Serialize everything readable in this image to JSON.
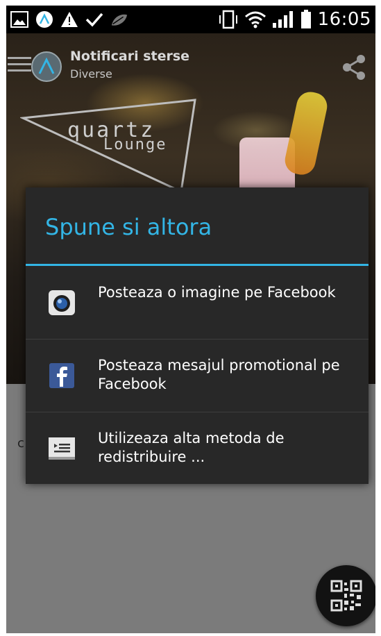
{
  "status_bar": {
    "time": "16:05",
    "left_icons": [
      "image-notification-icon",
      "app-notification-icon",
      "warning-icon",
      "check-icon",
      "leaf-icon"
    ],
    "right_icons": [
      "vibrate-icon",
      "wifi-icon",
      "signal-icon",
      "battery-icon"
    ]
  },
  "app_bar": {
    "title": "Notificari sterse",
    "subtitle": "Diverse"
  },
  "brand": {
    "name": "quartz",
    "sub": "Lounge"
  },
  "background_text": "c",
  "dialog": {
    "title": "Spune si altora",
    "options": [
      {
        "label": "Posteaza o imagine pe Facebook",
        "icon": "camera-icon"
      },
      {
        "label": "Posteaza mesajul promotional pe Facebook",
        "icon": "facebook-icon"
      },
      {
        "label": "Utilizeaza alta metoda de redistribuire ...",
        "icon": "share-list-icon"
      }
    ]
  },
  "colors": {
    "accent": "#33b5e5",
    "dialog_bg": "#282828",
    "lower_bg": "#7b7b7b"
  }
}
